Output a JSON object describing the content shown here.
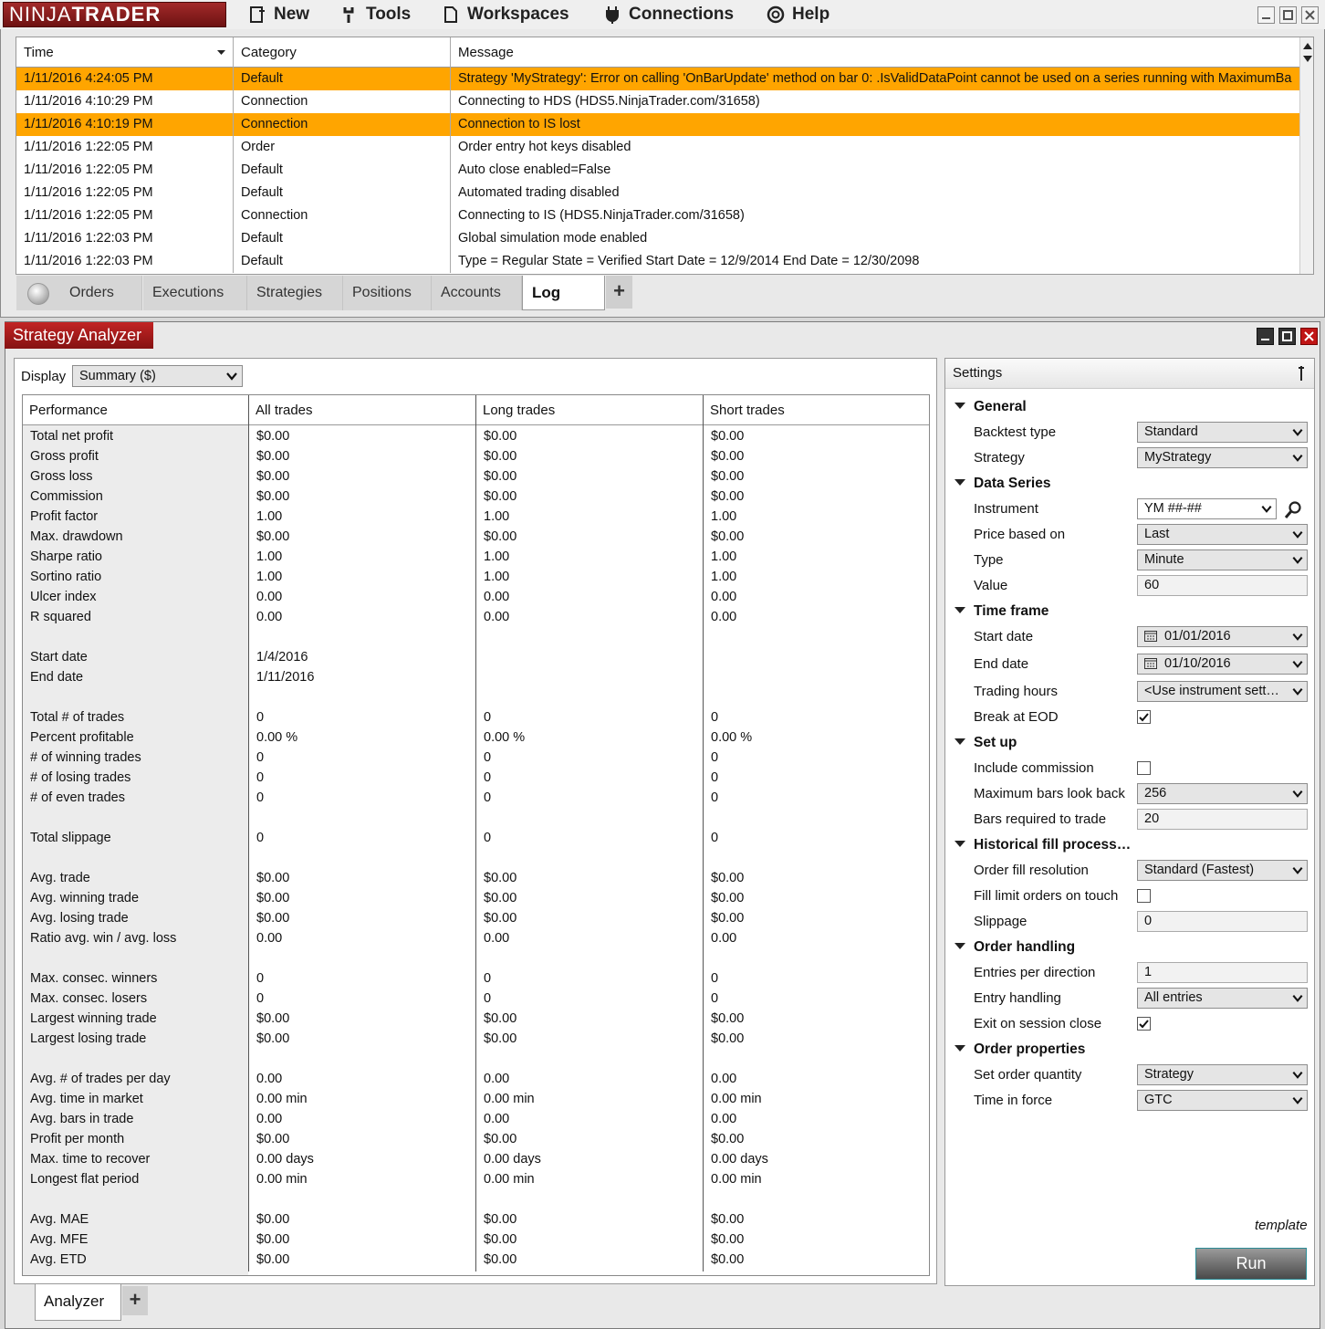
{
  "app": {
    "logo": "NINJATRADER",
    "menu": [
      {
        "label": "New",
        "icon": "new-icon"
      },
      {
        "label": "Tools",
        "icon": "wrench-icon"
      },
      {
        "label": "Workspaces",
        "icon": "document-icon"
      },
      {
        "label": "Connections",
        "icon": "plug-icon"
      },
      {
        "label": "Help",
        "icon": "lifebuoy-icon"
      }
    ]
  },
  "log": {
    "columns": [
      "Time",
      "Category",
      "Message"
    ],
    "rows": [
      {
        "time": "1/11/2016 4:24:05 PM",
        "category": "Default",
        "message": "Strategy 'MyStrategy': Error on calling 'OnBarUpdate' method on bar 0: .IsValidDataPoint cannot be used on a series running with MaximumBa",
        "highlight": true
      },
      {
        "time": "1/11/2016 4:10:29 PM",
        "category": "Connection",
        "message": "Connecting to HDS (HDS5.NinjaTrader.com/31658)",
        "highlight": false
      },
      {
        "time": "1/11/2016 4:10:19 PM",
        "category": "Connection",
        "message": "Connection to IS lost",
        "highlight": true
      },
      {
        "time": "1/11/2016 1:22:05 PM",
        "category": "Order",
        "message": "Order entry hot keys disabled",
        "highlight": false
      },
      {
        "time": "1/11/2016 1:22:05 PM",
        "category": "Default",
        "message": "Auto close enabled=False",
        "highlight": false
      },
      {
        "time": "1/11/2016 1:22:05 PM",
        "category": "Default",
        "message": "Automated trading disabled",
        "highlight": false
      },
      {
        "time": "1/11/2016 1:22:05 PM",
        "category": "Connection",
        "message": "Connecting to IS (HDS5.NinjaTrader.com/31658)",
        "highlight": false
      },
      {
        "time": "1/11/2016 1:22:03 PM",
        "category": "Default",
        "message": "Global simulation mode enabled",
        "highlight": false
      },
      {
        "time": "1/11/2016 1:22:03 PM",
        "category": "Default",
        "message": "Type = Regular State = Verified Start Date = 12/9/2014 End Date = 12/30/2098",
        "highlight": false
      }
    ],
    "highlight_color": "#ffa500"
  },
  "control_tabs": [
    "Orders",
    "Executions",
    "Strategies",
    "Positions",
    "Accounts",
    "Log"
  ],
  "control_tabs_active": "Log",
  "analyzer": {
    "title": "Strategy Analyzer",
    "display_label": "Display",
    "display_value": "Summary ($)",
    "columns": [
      "Performance",
      "All trades",
      "Long trades",
      "Short trades"
    ],
    "rows": [
      [
        "Total net profit",
        "$0.00",
        "$0.00",
        "$0.00"
      ],
      [
        "Gross profit",
        "$0.00",
        "$0.00",
        "$0.00"
      ],
      [
        "Gross loss",
        "$0.00",
        "$0.00",
        "$0.00"
      ],
      [
        "Commission",
        "$0.00",
        "$0.00",
        "$0.00"
      ],
      [
        "Profit factor",
        "1.00",
        "1.00",
        "1.00"
      ],
      [
        "Max. drawdown",
        "$0.00",
        "$0.00",
        "$0.00"
      ],
      [
        "Sharpe ratio",
        "1.00",
        "1.00",
        "1.00"
      ],
      [
        "Sortino ratio",
        "1.00",
        "1.00",
        "1.00"
      ],
      [
        "Ulcer index",
        "0.00",
        "0.00",
        "0.00"
      ],
      [
        "R squared",
        "0.00",
        "0.00",
        "0.00"
      ],
      [
        "",
        "",
        "",
        ""
      ],
      [
        "Start date",
        "1/4/2016",
        "",
        ""
      ],
      [
        "End date",
        "1/11/2016",
        "",
        ""
      ],
      [
        "",
        "",
        "",
        ""
      ],
      [
        "Total # of trades",
        "0",
        "0",
        "0"
      ],
      [
        "Percent profitable",
        "0.00 %",
        "0.00 %",
        "0.00 %"
      ],
      [
        "# of winning trades",
        "0",
        "0",
        "0"
      ],
      [
        "# of losing trades",
        "0",
        "0",
        "0"
      ],
      [
        "# of even trades",
        "0",
        "0",
        "0"
      ],
      [
        "",
        "",
        "",
        ""
      ],
      [
        "Total slippage",
        "0",
        "0",
        "0"
      ],
      [
        "",
        "",
        "",
        ""
      ],
      [
        "Avg. trade",
        "$0.00",
        "$0.00",
        "$0.00"
      ],
      [
        "Avg. winning trade",
        "$0.00",
        "$0.00",
        "$0.00"
      ],
      [
        "Avg. losing trade",
        "$0.00",
        "$0.00",
        "$0.00"
      ],
      [
        "Ratio avg. win / avg. loss",
        "0.00",
        "0.00",
        "0.00"
      ],
      [
        "",
        "",
        "",
        ""
      ],
      [
        "Max. consec. winners",
        "0",
        "0",
        "0"
      ],
      [
        "Max. consec. losers",
        "0",
        "0",
        "0"
      ],
      [
        "Largest winning trade",
        "$0.00",
        "$0.00",
        "$0.00"
      ],
      [
        "Largest losing trade",
        "$0.00",
        "$0.00",
        "$0.00"
      ],
      [
        "",
        "",
        "",
        ""
      ],
      [
        "Avg. # of trades per day",
        "0.00",
        "0.00",
        "0.00"
      ],
      [
        "Avg. time in market",
        "0.00 min",
        "0.00 min",
        "0.00 min"
      ],
      [
        "Avg. bars in trade",
        "0.00",
        "0.00",
        "0.00"
      ],
      [
        "Profit per month",
        "$0.00",
        "$0.00",
        "$0.00"
      ],
      [
        "Max. time to recover",
        "0.00 days",
        "0.00 days",
        "0.00 days"
      ],
      [
        "Longest flat period",
        "0.00 min",
        "0.00 min",
        "0.00 min"
      ],
      [
        "",
        "",
        "",
        ""
      ],
      [
        "Avg. MAE",
        "$0.00",
        "$0.00",
        "$0.00"
      ],
      [
        "Avg. MFE",
        "$0.00",
        "$0.00",
        "$0.00"
      ],
      [
        "Avg. ETD",
        "$0.00",
        "$0.00",
        "$0.00"
      ]
    ],
    "bottom_tab": "Analyzer"
  },
  "settings": {
    "title": "Settings",
    "template_label": "template",
    "run_label": "Run",
    "sections": [
      {
        "title": "General",
        "props": [
          {
            "label": "Backtest type",
            "value": "Standard",
            "kind": "select"
          },
          {
            "label": "Strategy",
            "value": "MyStrategy",
            "kind": "select"
          }
        ]
      },
      {
        "title": "Data Series",
        "props": [
          {
            "label": "Instrument",
            "value": "YM ##-##",
            "kind": "instrument"
          },
          {
            "label": "Price based on",
            "value": "Last",
            "kind": "select"
          },
          {
            "label": "Type",
            "value": "Minute",
            "kind": "select"
          },
          {
            "label": "Value",
            "value": "60",
            "kind": "text"
          }
        ]
      },
      {
        "title": "Time frame",
        "props": [
          {
            "label": "Start date",
            "value": "01/01/2016",
            "kind": "date"
          },
          {
            "label": "End date",
            "value": "01/10/2016",
            "kind": "date"
          },
          {
            "label": "Trading hours",
            "value": "<Use instrument sett…",
            "kind": "select"
          },
          {
            "label": "Break at EOD",
            "value": true,
            "kind": "check"
          }
        ]
      },
      {
        "title": "Set up",
        "props": [
          {
            "label": "Include commission",
            "value": false,
            "kind": "check"
          },
          {
            "label": "Maximum bars look back",
            "value": "256",
            "kind": "select"
          },
          {
            "label": "Bars required to trade",
            "value": "20",
            "kind": "text"
          }
        ]
      },
      {
        "title": "Historical fill process…",
        "props": [
          {
            "label": "Order fill resolution",
            "value": "Standard (Fastest)",
            "kind": "select"
          },
          {
            "label": "Fill limit orders on touch",
            "value": false,
            "kind": "check"
          },
          {
            "label": "Slippage",
            "value": "0",
            "kind": "text"
          }
        ]
      },
      {
        "title": "Order handling",
        "props": [
          {
            "label": "Entries per direction",
            "value": "1",
            "kind": "text"
          },
          {
            "label": "Entry handling",
            "value": "All entries",
            "kind": "select"
          },
          {
            "label": "Exit on session close",
            "value": true,
            "kind": "check"
          }
        ]
      },
      {
        "title": "Order properties",
        "props": [
          {
            "label": "Set order quantity",
            "value": "Strategy",
            "kind": "select"
          },
          {
            "label": "Time in force",
            "value": "GTC",
            "kind": "select"
          }
        ]
      }
    ]
  },
  "colors": {
    "brand_red": "#a22a2a",
    "highlight": "#ffa500",
    "run_button_border": "#2a8c96"
  }
}
